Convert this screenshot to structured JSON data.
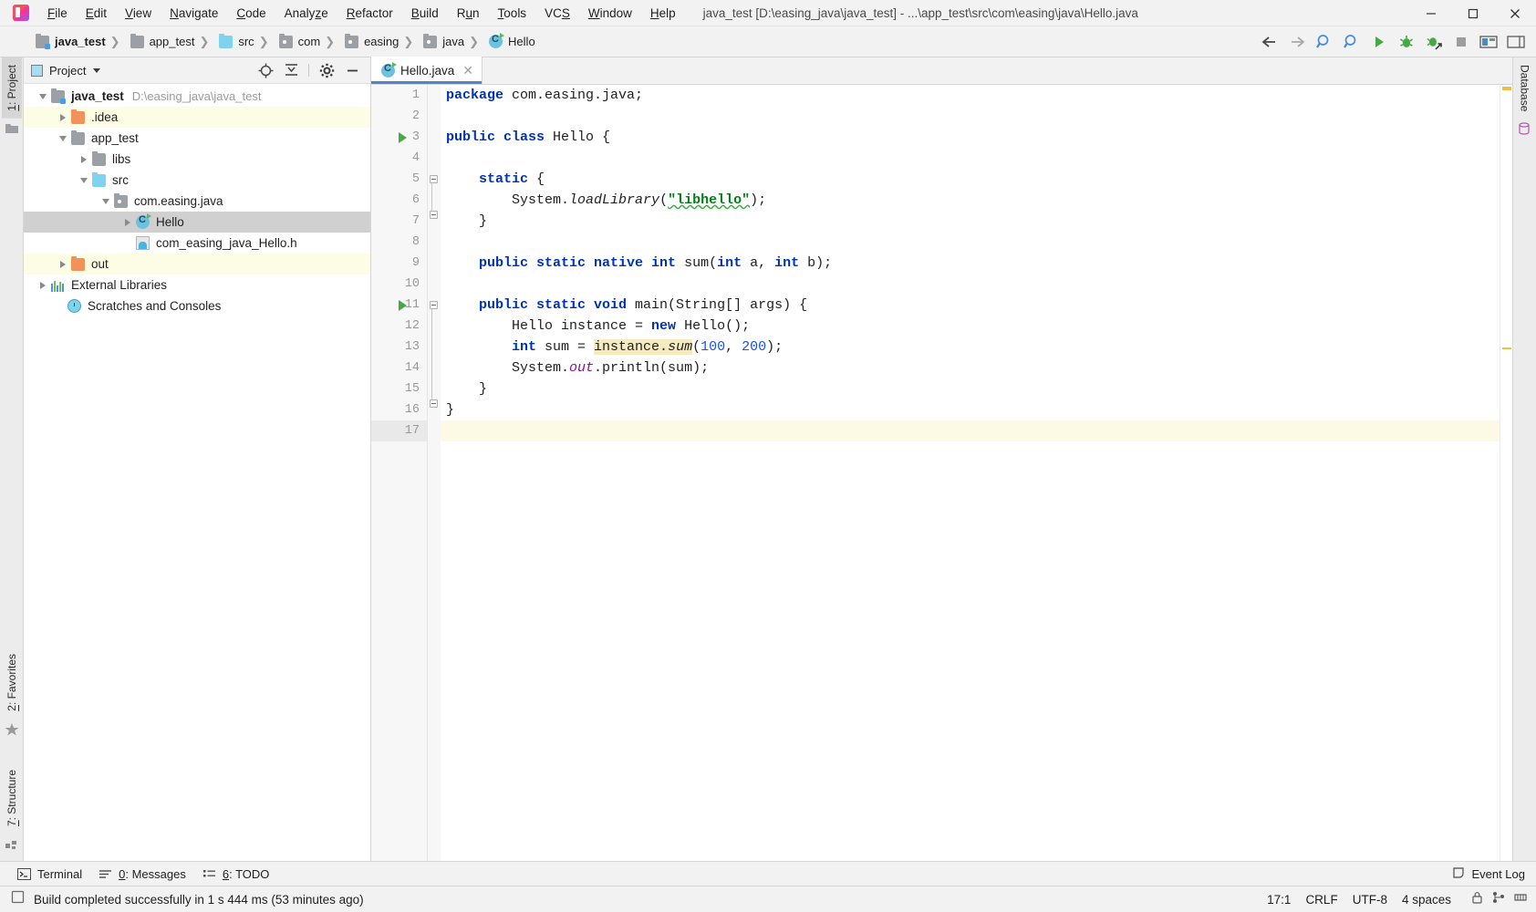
{
  "window": {
    "title": "java_test [D:\\easing_java\\java_test] - ...\\app_test\\src\\com\\easing\\java\\Hello.java",
    "minimize": "—",
    "maximize": "▢",
    "close": "✕",
    "logo_icon": "intellij-idea-logo"
  },
  "menu": [
    {
      "label": "File"
    },
    {
      "label": "Edit"
    },
    {
      "label": "View"
    },
    {
      "label": "Navigate"
    },
    {
      "label": "Code"
    },
    {
      "label": "Analyze"
    },
    {
      "label": "Refactor"
    },
    {
      "label": "Build"
    },
    {
      "label": "Run"
    },
    {
      "label": "Tools"
    },
    {
      "label": "VCS"
    },
    {
      "label": "Window"
    },
    {
      "label": "Help"
    }
  ],
  "breadcrumbs": [
    {
      "label": "java_test",
      "icon": "module-folder-icon",
      "bold": true
    },
    {
      "label": "app_test",
      "icon": "folder-gray-icon"
    },
    {
      "label": "src",
      "icon": "folder-blue-icon"
    },
    {
      "label": "com",
      "icon": "package-icon"
    },
    {
      "label": "easing",
      "icon": "package-icon"
    },
    {
      "label": "java",
      "icon": "package-icon"
    },
    {
      "label": "Hello",
      "icon": "java-class-icon"
    }
  ],
  "toolbar": [
    {
      "name": "back-button",
      "icon": "arrow-left-icon"
    },
    {
      "name": "forward-button",
      "icon": "arrow-right-icon"
    },
    {
      "name": "search-everywhere-button",
      "icon": "magnifier-icon"
    },
    {
      "name": "find-button",
      "icon": "magnifier-icon"
    },
    {
      "name": "run-button",
      "icon": "play-icon"
    },
    {
      "name": "debug-button",
      "icon": "bug-icon"
    },
    {
      "name": "run-with-coverage-button",
      "icon": "bug-arrow-icon"
    },
    {
      "name": "stop-button",
      "icon": "stop-square-icon"
    },
    {
      "name": "settings-button",
      "icon": "sliders-icon"
    },
    {
      "name": "hide-panels-button",
      "icon": "panel-icon"
    }
  ],
  "left_strip": {
    "tabs": [
      {
        "label": "1: Project",
        "underline": "1",
        "active": true,
        "icon": "folder-icon"
      },
      {
        "label": "2: Favorites",
        "underline": "2",
        "active": false,
        "icon": "star-icon"
      },
      {
        "label": "7: Structure",
        "underline": "7",
        "active": false,
        "icon": "grid-icon"
      }
    ]
  },
  "right_strip": {
    "tabs": [
      {
        "label": "Database",
        "active": false,
        "icon": "database-icon"
      }
    ]
  },
  "project_panel": {
    "title": "Project",
    "actions": [
      {
        "name": "locate-button",
        "icon": "crosshair-icon"
      },
      {
        "name": "collapse-all-button",
        "icon": "collapse-icon"
      },
      {
        "name": "settings-gear-button",
        "icon": "gear-icon"
      },
      {
        "name": "hide-button",
        "icon": "minimize-icon"
      }
    ],
    "tree": [
      {
        "label": "java_test",
        "path": "D:\\easing_java\\java_test",
        "depth": 0,
        "arrow": "open",
        "icon": "module-folder-icon",
        "bold": true,
        "selected": false,
        "tint": false
      },
      {
        "label": ".idea",
        "path": "",
        "depth": 1,
        "arrow": "closed",
        "icon": "folder-orange-icon",
        "bold": false,
        "selected": false,
        "tint": true
      },
      {
        "label": "app_test",
        "path": "",
        "depth": 1,
        "arrow": "open",
        "icon": "folder-gray-icon",
        "bold": false,
        "selected": false,
        "tint": false
      },
      {
        "label": "libs",
        "path": "",
        "depth": 2,
        "arrow": "closed",
        "icon": "folder-gray-icon",
        "bold": false,
        "selected": false,
        "tint": false
      },
      {
        "label": "src",
        "path": "",
        "depth": 2,
        "arrow": "open",
        "icon": "folder-blue-icon",
        "bold": false,
        "selected": false,
        "tint": false
      },
      {
        "label": "com.easing.java",
        "path": "",
        "depth": 3,
        "arrow": "open",
        "icon": "package-icon",
        "bold": false,
        "selected": false,
        "tint": false
      },
      {
        "label": "Hello",
        "path": "",
        "depth": 4,
        "arrow": "closed",
        "icon": "java-class-icon",
        "bold": false,
        "selected": true,
        "tint": false
      },
      {
        "label": "com_easing_java_Hello.h",
        "path": "",
        "depth": 4,
        "arrow": "none",
        "icon": "header-file-icon",
        "bold": false,
        "selected": false,
        "tint": false
      },
      {
        "label": "out",
        "path": "",
        "depth": 1,
        "arrow": "closed",
        "icon": "folder-orange-icon",
        "bold": false,
        "selected": false,
        "tint": true
      },
      {
        "label": "External Libraries",
        "path": "",
        "depth": 0,
        "arrow": "closed",
        "icon": "libraries-icon",
        "bold": false,
        "selected": false,
        "tint": false
      },
      {
        "label": "Scratches and Consoles",
        "path": "",
        "depth": 0,
        "arrow": "none",
        "icon": "scratches-icon",
        "bold": false,
        "selected": false,
        "tint": false
      }
    ]
  },
  "editor": {
    "tab": {
      "label": "Hello.java",
      "icon": "java-class-icon",
      "close": "✕"
    },
    "caret_line": 17,
    "lines": [
      {
        "n": 1,
        "run": false,
        "fold": "none"
      },
      {
        "n": 2,
        "run": false,
        "fold": "none"
      },
      {
        "n": 3,
        "run": true,
        "fold": "none"
      },
      {
        "n": 4,
        "run": false,
        "fold": "none"
      },
      {
        "n": 5,
        "run": false,
        "fold": "start"
      },
      {
        "n": 6,
        "run": false,
        "fold": "bar"
      },
      {
        "n": 7,
        "run": false,
        "fold": "end"
      },
      {
        "n": 8,
        "run": false,
        "fold": "none"
      },
      {
        "n": 9,
        "run": false,
        "fold": "none"
      },
      {
        "n": 10,
        "run": false,
        "fold": "none"
      },
      {
        "n": 11,
        "run": true,
        "fold": "start"
      },
      {
        "n": 12,
        "run": false,
        "fold": "bar"
      },
      {
        "n": 13,
        "run": false,
        "fold": "bar"
      },
      {
        "n": 14,
        "run": false,
        "fold": "bar"
      },
      {
        "n": 15,
        "run": false,
        "fold": "end"
      },
      {
        "n": 16,
        "run": false,
        "fold": "none"
      },
      {
        "n": 17,
        "run": false,
        "fold": "none"
      }
    ],
    "code_text": [
      "package com.easing.java;",
      "",
      "public class Hello {",
      "",
      "    static {",
      "        System.loadLibrary(\"libhello\");",
      "    }",
      "",
      "    public static native int sum(int a, int b);",
      "",
      "    public static void main(String[] args) {",
      "        Hello instance = new Hello();",
      "        int sum = instance.sum(100, 200);",
      "        System.out.println(sum);",
      "    }",
      "}",
      ""
    ]
  },
  "bottom_bar": {
    "items": [
      {
        "label": "Terminal",
        "underline": "",
        "icon": "terminal-icon"
      },
      {
        "label": "0: Messages",
        "underline": "0",
        "icon": "messages-icon"
      },
      {
        "label": "6: TODO",
        "underline": "6",
        "icon": "todo-icon"
      }
    ],
    "event_log": {
      "label": "Event Log",
      "icon": "event-log-icon"
    }
  },
  "status_bar": {
    "message": "Build completed successfully in 1 s 444 ms (53 minutes ago)",
    "message_icon": "build-icon",
    "position": "17:1",
    "line_separator": "CRLF",
    "encoding": "UTF-8",
    "indent": "4 spaces",
    "icons": [
      {
        "name": "lock-icon"
      },
      {
        "name": "vcs-branch-icon"
      },
      {
        "name": "memory-icon"
      }
    ]
  },
  "colors": {
    "accent_blue": "#4a88c7",
    "keyword": "#0033b3",
    "string": "#067d17",
    "number": "#1750eb",
    "field": "#871094",
    "selection": "#d0d0d0",
    "tint": "#fdfce4",
    "run_green": "#46a946"
  }
}
